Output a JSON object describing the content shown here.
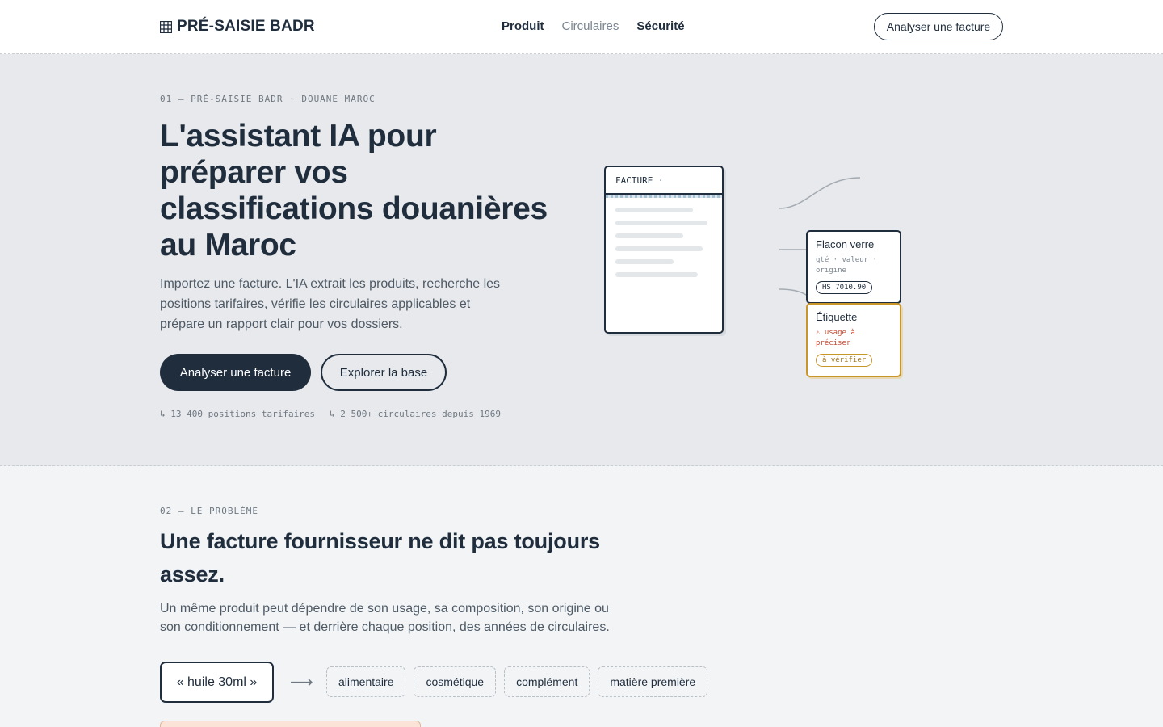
{
  "header": {
    "logo": "PRÉ-SAISIE BADR",
    "nav": [
      "Produit",
      "Circulaires",
      "Sécurité"
    ],
    "cta": "Analyser une facture"
  },
  "hero": {
    "eyebrow": "01 — PRÉ-SAISIE BADR · DOUANE MAROC",
    "title": "L'assistant IA pour préparer vos classifications douanières au Maroc",
    "subtitle": "Importez une facture. L'IA extrait les produits, recherche les positions tarifaires, vérifie les circulaires applicables et prépare un rapport clair pour vos dossiers.",
    "primary_button": "Analyser une facture",
    "secondary_button": "Explorer la base",
    "stats": [
      "↳ 13 400 positions tarifaires",
      "↳ 2 500+ circulaires depuis 1969"
    ]
  },
  "illustration": {
    "doc_label": "FACTURE ·",
    "card1": {
      "title": "Flacon verre",
      "meta": "qté · valeur · origine",
      "tag": "HS 7010.90"
    },
    "card2": {
      "title": "Étiquette",
      "warn": "⚠ usage à préciser",
      "tag": "à vérifier"
    }
  },
  "problem": {
    "eyebrow": "02 — LE PROBLÈME",
    "title": "Une facture fournisseur ne dit pas toujours assez.",
    "subtitle": "Un même produit peut dépendre de son usage, sa composition, son origine ou son conditionnement — et derrière chaque position, des années de circulaires.",
    "term": "« huile 30ml »",
    "arrow": "⟶",
    "chips": [
      "alimentaire",
      "cosmétique",
      "complément",
      "matière première"
    ]
  },
  "colors": {
    "ink": "#1f2d3d",
    "hero_bg": "#e7e9ec",
    "page_bg": "#f2f4f6",
    "warning": "#c8452c",
    "amber": "#c9962a"
  }
}
